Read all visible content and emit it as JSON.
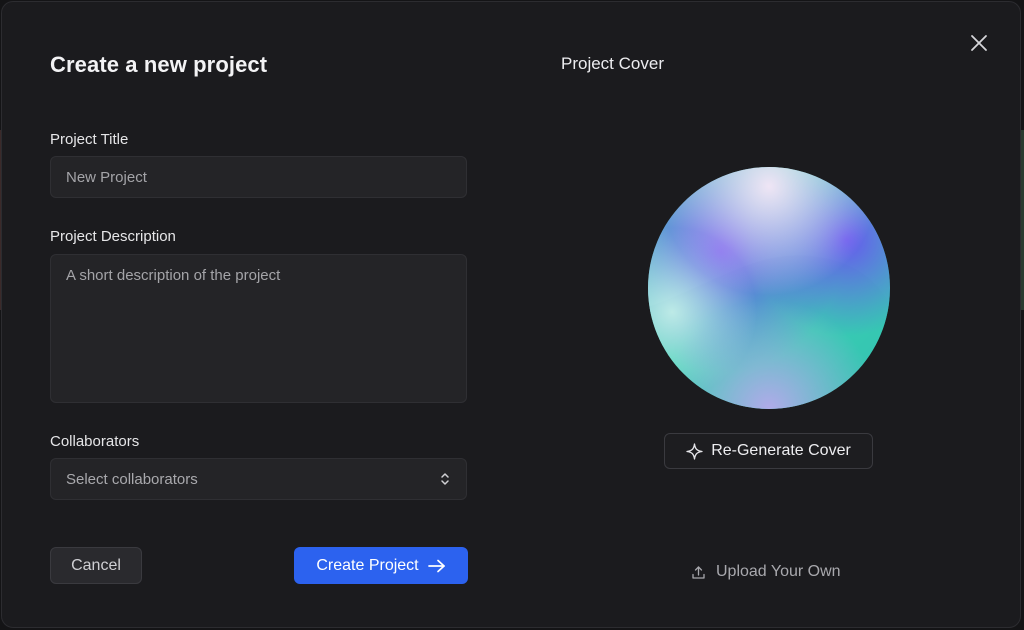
{
  "modal": {
    "title": "Create a new project"
  },
  "form": {
    "title_label": "Project Title",
    "title_placeholder": "New Project",
    "title_value": "",
    "description_label": "Project Description",
    "description_placeholder": "A short description of the project",
    "description_value": "",
    "collaborators_label": "Collaborators",
    "collaborators_value": "Select collaborators"
  },
  "actions": {
    "cancel_label": "Cancel",
    "create_label": "Create Project"
  },
  "cover": {
    "title": "Project Cover",
    "regenerate_label": "Re-Generate Cover",
    "upload_label": "Upload Your Own"
  },
  "icons": {
    "close": "close-icon",
    "chevrons": "chevron-up-down-icon",
    "arrow": "arrow-right-icon",
    "sparkle": "sparkle-icon",
    "upload": "upload-icon"
  },
  "colors": {
    "modal_bg": "#1b1b1e",
    "field_bg": "#242427",
    "accent": "#2c62ef",
    "text_primary": "#f3f3f5",
    "text_muted": "#a9a9ad",
    "orb_purple": "#6b5cf0",
    "orb_teal": "#39d1b4",
    "orb_mint": "#9ff0d4"
  }
}
